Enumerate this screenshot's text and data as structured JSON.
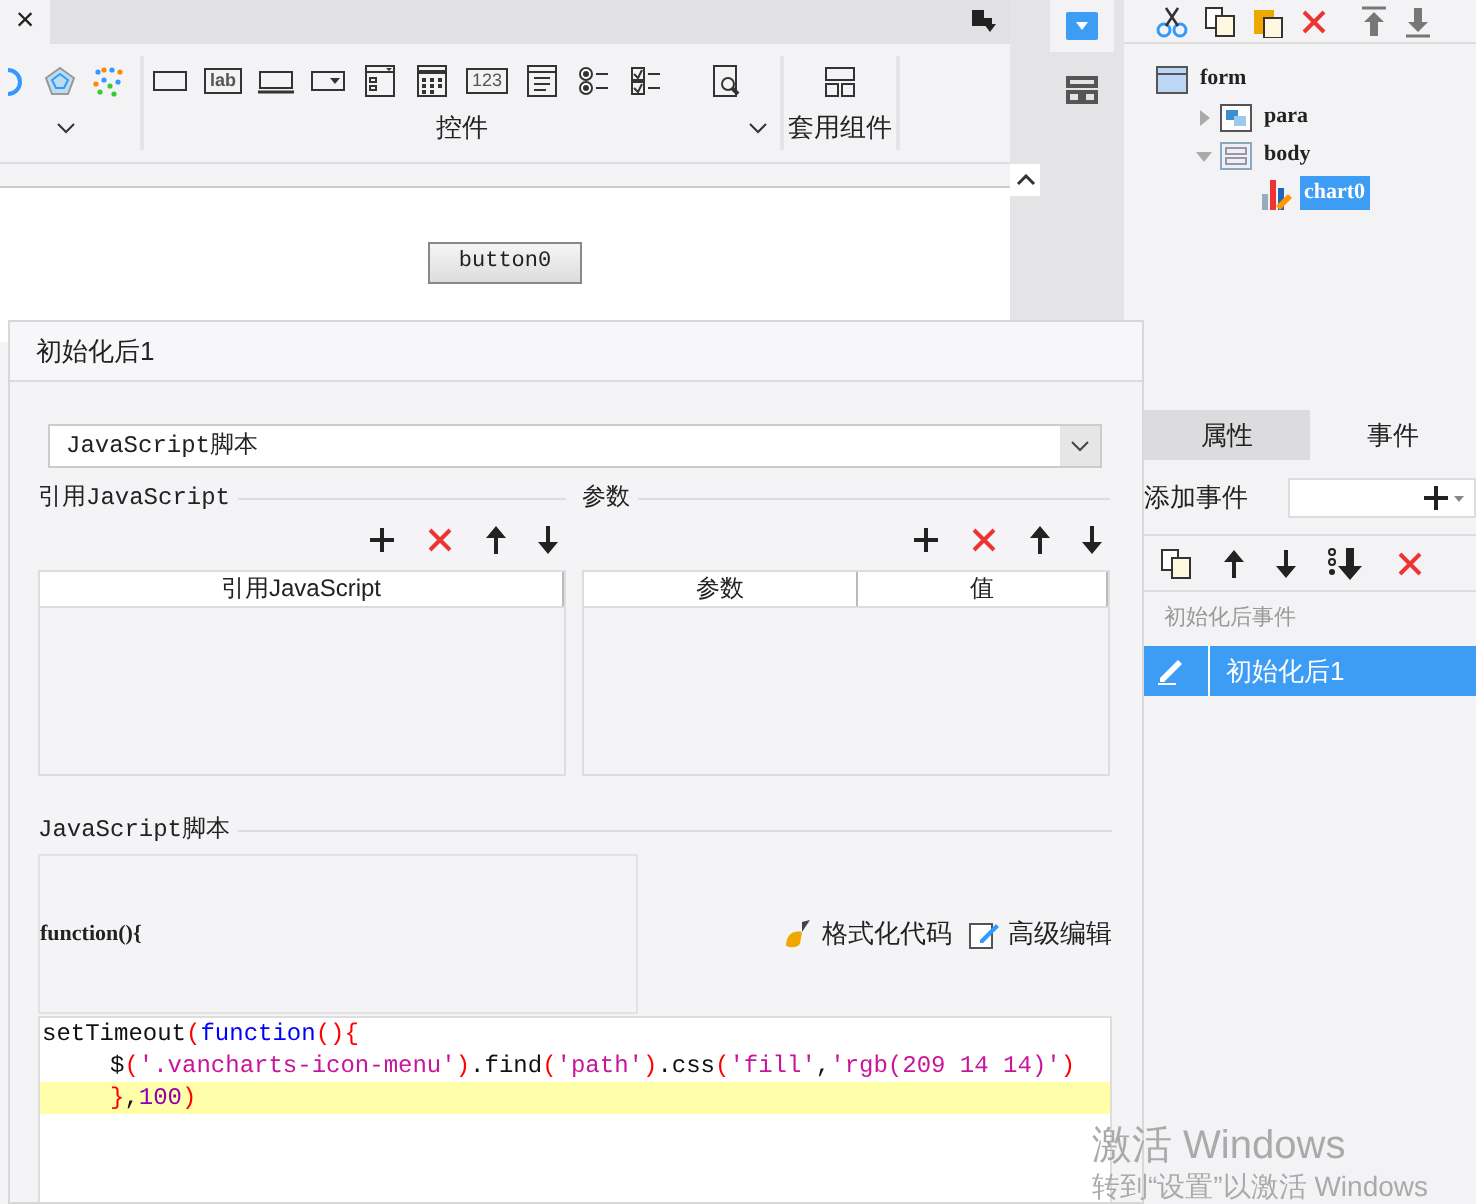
{
  "editor_tab": {
    "close": "×"
  },
  "toolbar": {
    "groups": [
      {
        "kind": "charts"
      },
      {
        "label": "控件",
        "kind": "widgets"
      },
      {
        "label": "套用组件",
        "kind": "layouts"
      }
    ],
    "widgets": [
      {
        "kind": "textbox"
      },
      {
        "kind": "label",
        "text": "lab"
      },
      {
        "kind": "button"
      },
      {
        "kind": "combo"
      },
      {
        "kind": "listbox"
      },
      {
        "kind": "date"
      },
      {
        "kind": "number",
        "text": "123"
      },
      {
        "kind": "textarea"
      },
      {
        "kind": "radio"
      },
      {
        "kind": "checkbox"
      },
      {
        "kind": "preview"
      }
    ]
  },
  "canvas": {
    "button": "button0"
  },
  "structure_tree": [
    {
      "label": "form",
      "kind": "form",
      "selected": false,
      "children": [
        {
          "label": "para",
          "kind": "para",
          "expanded": false,
          "selected": false
        },
        {
          "label": "body",
          "kind": "body",
          "expanded": true,
          "selected": false,
          "children": [
            {
              "label": "chart0",
              "kind": "chart",
              "selected": true
            }
          ]
        }
      ]
    }
  ],
  "property_tabs": [
    {
      "label": "属性",
      "selected": false
    },
    {
      "label": "事件",
      "selected": true
    }
  ],
  "add_event": {
    "label": "添加事件"
  },
  "event_group": "初始化后事件",
  "events": [
    {
      "label": "初始化后1",
      "selected": true
    }
  ],
  "dialog": {
    "title": "初始化后1",
    "script_type": "JavaScript脚本",
    "ref_section": {
      "title": "引用JavaScript",
      "columns": [
        "引用JavaScript"
      ]
    },
    "param_section": {
      "title": "参数",
      "columns": [
        "参数",
        "值"
      ]
    },
    "script_section": {
      "title": "JavaScript脚本",
      "signature": "function(){",
      "actions": [
        {
          "label": "格式化代码",
          "kind": "format"
        },
        {
          "label": "高级编辑",
          "kind": "edit"
        }
      ],
      "code_lines": [
        {
          "indented": false,
          "highlighted": false,
          "tokens": [
            {
              "kind": "plain",
              "text": "setTimeout"
            },
            {
              "kind": "paren",
              "text": "("
            },
            {
              "kind": "keyword",
              "text": "function"
            },
            {
              "kind": "paren",
              "text": "(){"
            }
          ]
        },
        {
          "indented": true,
          "highlighted": false,
          "tokens": [
            {
              "kind": "plain",
              "text": "$"
            },
            {
              "kind": "paren",
              "text": "("
            },
            {
              "kind": "string",
              "text": "'.vancharts-icon-menu'"
            },
            {
              "kind": "paren",
              "text": ")"
            },
            {
              "kind": "plain",
              "text": ".find"
            },
            {
              "kind": "paren",
              "text": "("
            },
            {
              "kind": "string",
              "text": "'path'"
            },
            {
              "kind": "paren",
              "text": ")"
            },
            {
              "kind": "plain",
              "text": ".css"
            },
            {
              "kind": "paren",
              "text": "("
            },
            {
              "kind": "string",
              "text": "'fill'"
            },
            {
              "kind": "plain",
              "text": ","
            },
            {
              "kind": "string",
              "text": "'rgb(209 14 14)'"
            },
            {
              "kind": "paren",
              "text": ")"
            }
          ]
        },
        {
          "indented": true,
          "highlighted": true,
          "tokens": [
            {
              "kind": "paren",
              "text": "}"
            },
            {
              "kind": "plain",
              "text": ","
            },
            {
              "kind": "number",
              "text": "100"
            },
            {
              "kind": "paren",
              "text": ")"
            }
          ]
        }
      ]
    }
  },
  "activation_notice": {
    "title": "激活 Windows",
    "subtitle": "转到“设置”以激活 Windows"
  }
}
